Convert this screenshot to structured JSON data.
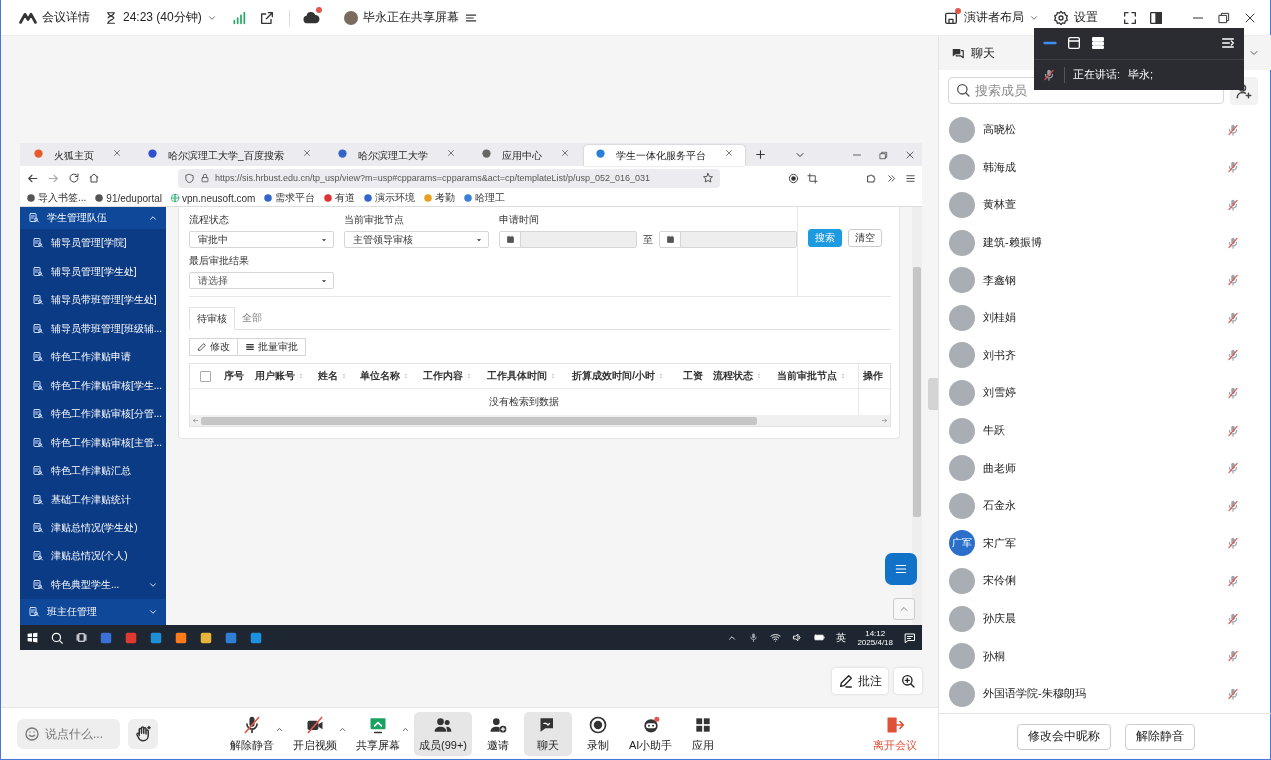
{
  "topbar": {
    "meeting_info": "会议详情",
    "timer": "24:23 (40分钟)",
    "sharer": "毕永正在共享屏幕",
    "layout": "演讲者布局",
    "settings": "设置"
  },
  "speaker": {
    "label": "正在讲话:",
    "name": "毕永;"
  },
  "browser": {
    "tabs": [
      {
        "label": "火狐主页",
        "selected": false
      },
      {
        "label": "哈尔滨理工大学_百度搜索",
        "selected": false
      },
      {
        "label": "哈尔滨理工大学",
        "selected": false
      },
      {
        "label": "应用中心",
        "selected": false
      },
      {
        "label": "学生一体化服务平台",
        "selected": true
      }
    ],
    "url": "https://sis.hrbust.edu.cn/tp_usp/view?m=usp#cpparams=cpparams&act=cp/templateList/p/usp_052_016_031",
    "bookmarks": [
      "导入书签...",
      "91/eduportal",
      "vpn.neusoft.com",
      "需求平台",
      "有道",
      "演示环境",
      "考勤",
      "哈理工"
    ]
  },
  "sidebar": [
    {
      "kind": "group",
      "label": "学生管理队伍",
      "expanded": true
    },
    {
      "kind": "item",
      "label": "辅导员管理[学院]"
    },
    {
      "kind": "item",
      "label": "辅导员管理[学生处]"
    },
    {
      "kind": "item",
      "label": "辅导员带班管理[学生处]"
    },
    {
      "kind": "item",
      "label": "辅导员带班管理[班级辅..."
    },
    {
      "kind": "item",
      "label": "特色工作津贴申请"
    },
    {
      "kind": "item",
      "label": "特色工作津贴审核[学生..."
    },
    {
      "kind": "item",
      "label": "特色工作津贴审核[分管..."
    },
    {
      "kind": "item",
      "label": "特色工作津贴审核[主管..."
    },
    {
      "kind": "item",
      "label": "特色工作津贴汇总"
    },
    {
      "kind": "item",
      "label": "基础工作津贴统计"
    },
    {
      "kind": "item",
      "label": "津贴总情况(学生处)"
    },
    {
      "kind": "item",
      "label": "津贴总情况(个人)"
    },
    {
      "kind": "submenu",
      "label": "特色典型学生...",
      "expanded": false
    },
    {
      "kind": "group",
      "label": "班主任管理",
      "expanded": false
    }
  ],
  "filters": {
    "fields": [
      {
        "label": "流程状态",
        "value": "审批中"
      },
      {
        "label": "当前审批节点",
        "value": "主管领导审核"
      },
      {
        "label": "最后审批结果",
        "placeholder": "请选择"
      }
    ],
    "date": {
      "label": "申请时间",
      "separator": "至"
    },
    "buttons": [
      "搜索",
      "清空"
    ]
  },
  "list_tabs": [
    {
      "label": "待审核",
      "selected": true
    },
    {
      "label": "全部",
      "selected": false
    }
  ],
  "actions": [
    "修改",
    "批量审批"
  ],
  "table": {
    "columns": [
      {
        "label": "序号",
        "sortable": false
      },
      {
        "label": "用户账号",
        "sortable": true
      },
      {
        "label": "姓名",
        "sortable": true
      },
      {
        "label": "单位名称",
        "sortable": true
      },
      {
        "label": "工作内容",
        "sortable": true
      },
      {
        "label": "工作具体时间",
        "sortable": true
      },
      {
        "label": "折算成效时间/小时",
        "sortable": true
      },
      {
        "label": "工资",
        "sortable": false
      },
      {
        "label": "流程状态",
        "sortable": true
      },
      {
        "label": "当前审批节点",
        "sortable": true
      },
      {
        "label": "操作",
        "sortable": false
      }
    ],
    "select_all_checked": false,
    "empty_text": "没有检索到数据"
  },
  "taskbar": {
    "ime": "英",
    "time": "14:12",
    "date": "2025/4/18"
  },
  "annotate_button": "批注",
  "chat_input": {
    "placeholder": "说点什么..."
  },
  "toolbar": [
    {
      "kind": "mic",
      "label": "解除静音",
      "selected": false
    },
    {
      "kind": "video",
      "label": "开启视频",
      "selected": false
    },
    {
      "kind": "share",
      "label": "共享屏幕",
      "selected": false
    },
    {
      "kind": "members",
      "label": "成员(99+)",
      "selected": true
    },
    {
      "kind": "invite",
      "label": "邀请",
      "selected": false
    },
    {
      "kind": "chat",
      "label": "聊天",
      "selected": true
    },
    {
      "kind": "record",
      "label": "录制",
      "selected": false
    },
    {
      "kind": "assistant",
      "label": "AI小助手",
      "selected": false
    },
    {
      "kind": "apps",
      "label": "应用",
      "selected": false
    }
  ],
  "leave": "离开会议",
  "panel": {
    "title": "聊天",
    "search_placeholder": "搜索成员",
    "members": [
      {
        "name": "高晓松",
        "muted": true
      },
      {
        "name": "韩海成",
        "muted": true
      },
      {
        "name": "黄林萱",
        "muted": true
      },
      {
        "name": "建筑-赖振博",
        "muted": true
      },
      {
        "name": "李鑫钢",
        "muted": true
      },
      {
        "name": "刘桂娟",
        "muted": true
      },
      {
        "name": "刘书齐",
        "muted": true
      },
      {
        "name": "刘雪婷",
        "muted": true
      },
      {
        "name": "牛跃",
        "muted": true
      },
      {
        "name": "曲老师",
        "muted": true
      },
      {
        "name": "石金永",
        "muted": true
      },
      {
        "name": "宋广军",
        "muted": true,
        "avatar_text": "广军"
      },
      {
        "name": "宋伶俐",
        "muted": true
      },
      {
        "name": "孙庆晨",
        "muted": true
      },
      {
        "name": "孙桐",
        "muted": true
      },
      {
        "name": "外国语学院-朱穆朗玛",
        "muted": true
      }
    ],
    "buttons": [
      "修改会中昵称",
      "解除静音"
    ]
  }
}
